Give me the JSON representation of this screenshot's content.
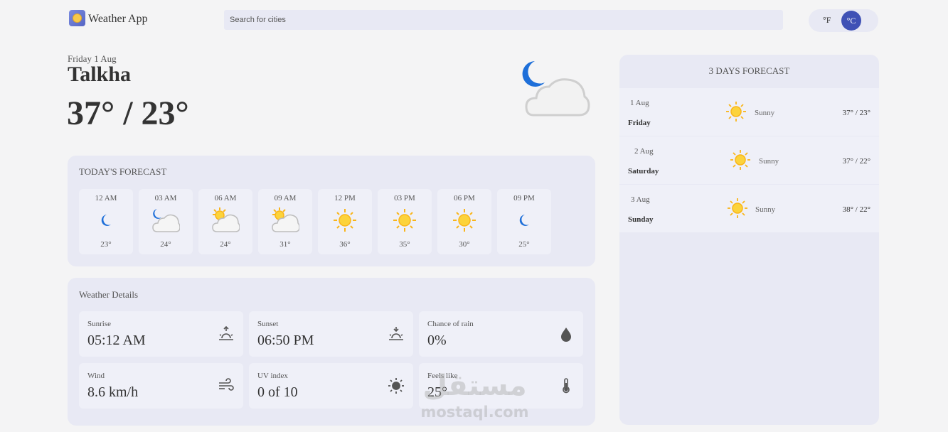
{
  "app": {
    "title": "Weather App"
  },
  "search": {
    "placeholder": "Search for cities"
  },
  "units": {
    "fahrenheit": "°F",
    "celsius": "°C",
    "selected": "°C"
  },
  "current": {
    "date": "Friday 1 Aug",
    "city": "Talkha",
    "temps": "37° / 23°",
    "icon": "moon-cloud-icon"
  },
  "today": {
    "title": "TODAY'S FORECAST",
    "hours": [
      {
        "time": "12 AM",
        "icon": "moon-icon",
        "temp": "23°"
      },
      {
        "time": "03 AM",
        "icon": "moon-cloud-icon",
        "temp": "24°"
      },
      {
        "time": "06 AM",
        "icon": "sun-cloud-icon",
        "temp": "24°"
      },
      {
        "time": "09 AM",
        "icon": "sun-cloud-icon",
        "temp": "31°"
      },
      {
        "time": "12 PM",
        "icon": "sun-icon",
        "temp": "36°"
      },
      {
        "time": "03 PM",
        "icon": "sun-icon",
        "temp": "35°"
      },
      {
        "time": "06 PM",
        "icon": "sun-icon",
        "temp": "30°"
      },
      {
        "time": "09 PM",
        "icon": "moon-icon",
        "temp": "25°"
      }
    ]
  },
  "details": {
    "title": "Weather Details",
    "items": [
      {
        "label": "Sunrise",
        "value": "05:12 AM",
        "icon": "sunrise-icon"
      },
      {
        "label": "Sunset",
        "value": "06:50 PM",
        "icon": "sunset-icon"
      },
      {
        "label": "Chance of rain",
        "value": "0%",
        "icon": "droplet-icon"
      },
      {
        "label": "Wind",
        "value": "8.6 km/h",
        "icon": "wind-icon"
      },
      {
        "label": "UV index",
        "value": "0 of 10",
        "icon": "sun-outline-icon"
      },
      {
        "label": "Feels like",
        "value": "25°",
        "icon": "thermometer-icon"
      }
    ]
  },
  "forecast": {
    "title": "3 DAYS FORECAST",
    "days": [
      {
        "date": "1 Aug",
        "day": "Friday",
        "condition": "Sunny",
        "temps": "37° / 23°",
        "icon": "sun-icon"
      },
      {
        "date": "2 Aug",
        "day": "Saturday",
        "condition": "Sunny",
        "temps": "37° / 22°",
        "icon": "sun-icon"
      },
      {
        "date": "3 Aug",
        "day": "Sunday",
        "condition": "Sunny",
        "temps": "38° / 22°",
        "icon": "sun-icon"
      }
    ]
  },
  "watermark": {
    "arabic": "مستقل",
    "latin": "mostaql.com"
  },
  "colors": {
    "accent": "#3f51b5",
    "panel": "#e8e9f4",
    "card": "#eff0f8",
    "sun": "#f9b51a",
    "moon": "#1e6fd9"
  }
}
